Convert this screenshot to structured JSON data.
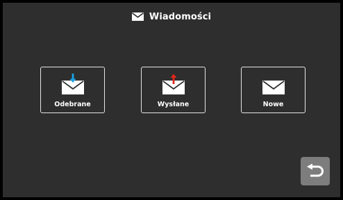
{
  "header": {
    "icon": "envelope-icon",
    "title": "Wiadomości"
  },
  "tiles": [
    {
      "label": "Odebrane",
      "icon": "envelope-received-icon",
      "arrow_color": "#1aa3e8"
    },
    {
      "label": "Wysłane",
      "icon": "envelope-sent-icon",
      "arrow_color": "#e0261b"
    },
    {
      "label": "Nowe",
      "icon": "envelope-new-icon"
    }
  ],
  "back_button": {
    "icon": "return-arrow-icon"
  },
  "colors": {
    "background": "#2e2e2e",
    "frame": "#000000",
    "tile_border": "#e6e6e6",
    "back_button": "#7d7d7d"
  }
}
